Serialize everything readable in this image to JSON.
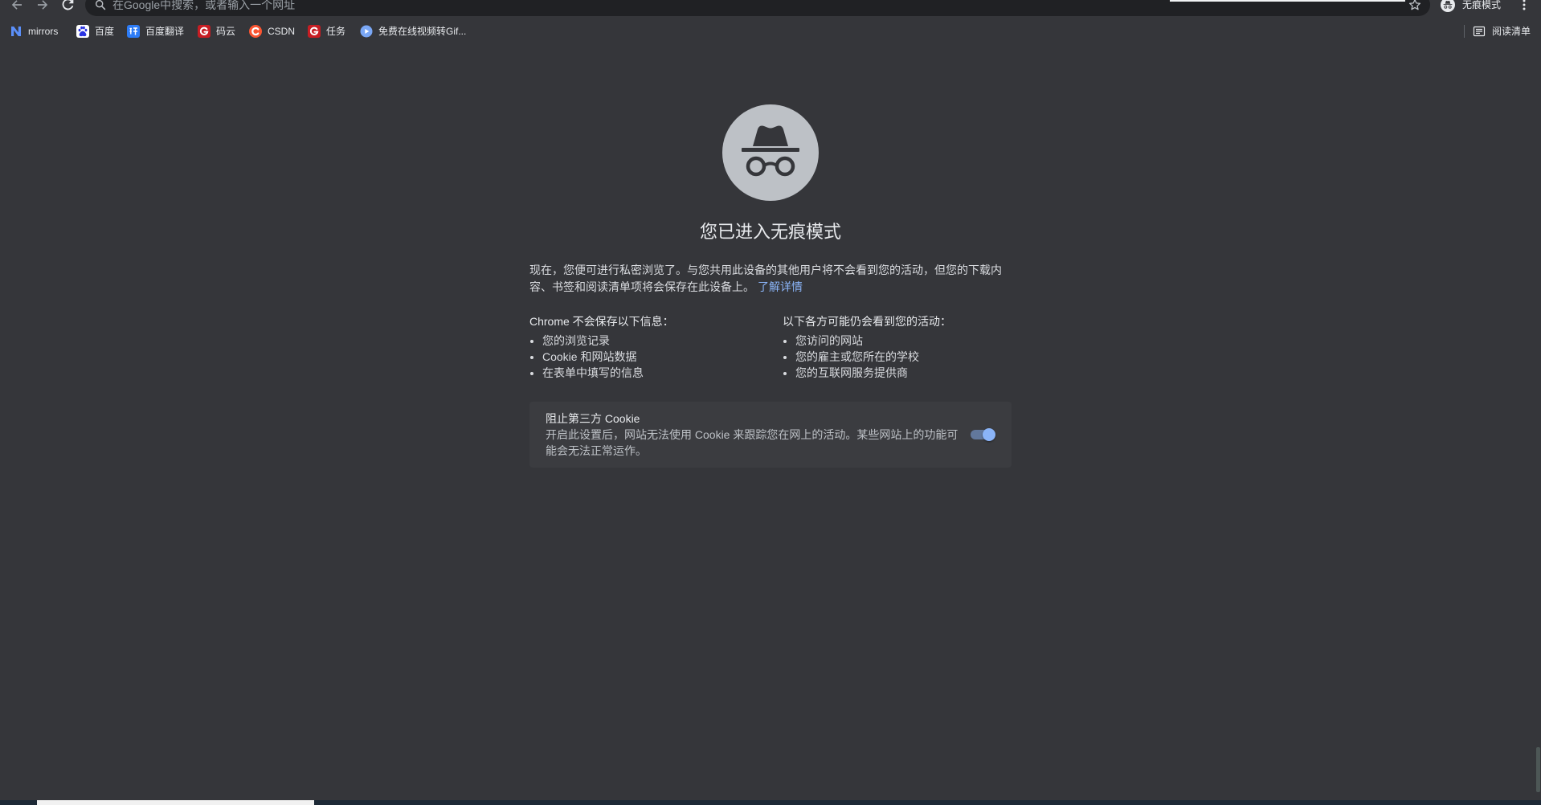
{
  "browser": {
    "toolbar": {
      "omnibox_placeholder": "在Google中搜索，或者输入一个网址",
      "profile_label": "无痕模式",
      "icons": [
        "back-arrow-icon",
        "forward-arrow-icon",
        "reload-icon",
        "search-icon",
        "star-icon",
        "incognito-avatar-icon",
        "more-vert-icon"
      ]
    },
    "bookmarks": [
      {
        "label": "mirrors",
        "icon": "mirrors-favicon-icon"
      },
      {
        "label": "百度",
        "icon": "baidu-favicon-icon"
      },
      {
        "label": "百度翻译",
        "icon": "baidu-translate-favicon-icon"
      },
      {
        "label": "码云",
        "icon": "gitee-favicon-icon"
      },
      {
        "label": "CSDN",
        "icon": "csdn-favicon-icon"
      },
      {
        "label": "任务",
        "icon": "gitee-favicon-icon"
      },
      {
        "label": "免费在线视频转Gif...",
        "icon": "gif-converter-favicon-icon"
      }
    ],
    "reading_list": {
      "label": "阅读清单",
      "icon": "reading-list-icon"
    }
  },
  "page": {
    "hero_icon": "incognito-icon",
    "title": "您已进入无痕模式",
    "intro": "现在，您便可进行私密浏览了。与您共用此设备的其他用户将不会看到您的活动，但您的下载内容、书签和阅读清单项将会保存在此设备上。",
    "learn_more": "了解详情",
    "not_saved": {
      "heading": "Chrome 不会保存以下信息：",
      "items": [
        "您的浏览记录",
        "Cookie 和网站数据",
        "在表单中填写的信息"
      ]
    },
    "may_see": {
      "heading": "以下各方可能仍会看到您的活动：",
      "items": [
        "您访问的网站",
        "您的雇主或您所在的学校",
        "您的互联网服务提供商"
      ]
    },
    "cookie_controls": {
      "title": "阻止第三方 Cookie",
      "description": "开启此设置后，网站无法使用 Cookie 来跟踪您在网上的活动。某些网站上的功能可能会无法正常运作。",
      "enabled": true
    }
  },
  "colors": {
    "page_background": "#35363a",
    "text": "#e8eaed",
    "link": "#8ab4f8",
    "toggle_on": "#8ab4f8"
  }
}
